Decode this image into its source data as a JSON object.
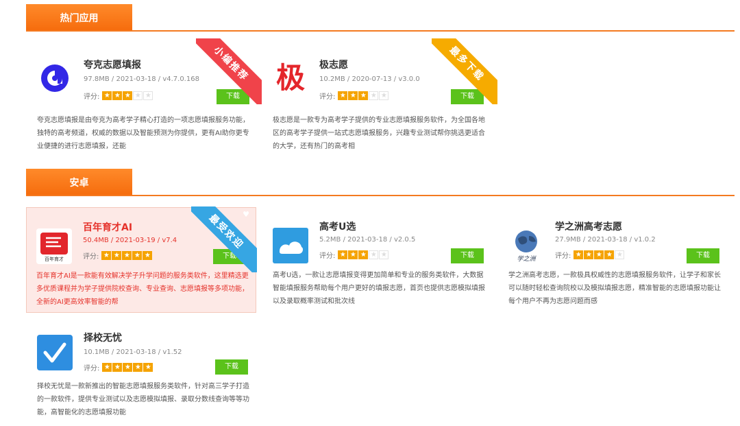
{
  "sections": {
    "hot": {
      "title": "热门应用"
    },
    "android": {
      "title": "安卓"
    }
  },
  "rating_label": "评分:",
  "download_label": "下载",
  "apps": {
    "kuake": {
      "title": "夸克志愿填报",
      "meta": "97.8MB / 2021-03-18 / v4.7.0.168",
      "rating": 3,
      "badge": "小编推荐",
      "badge_color": "#f0434a",
      "description": "夸克志愿填报是由夸克为高考学子精心打造的一项志愿填报服务功能，独特的高考频道，权威的数据以及智能预测为你提供，更有AI助你更专业便捷的进行志愿填报，还能"
    },
    "ji": {
      "title": "极志愿",
      "icon_char": "极",
      "meta": "10.2MB / 2020-07-13 / v3.0.0",
      "rating": 3,
      "badge": "最多下载",
      "badge_color": "#f6ab00",
      "description": "极志愿是一款专为高考学子提供的专业志愿填报服务软件，为全国各地区的高考学子提供一站式志愿填报服务，兴趣专业测试帮你挑选更适合的大学，还有热门的高考相"
    },
    "bainian": {
      "title": "百年育才AI",
      "icon_caption": "百年育才",
      "meta": "50.4MB / 2021-03-19 / v7.4",
      "rating": 5,
      "badge": "最受欢迎",
      "badge_color": "#36a6e3",
      "description": "百年育才AI是一款能有效解决学子升学问题的服务类软件，这里精选更多优质课程并为学子提供院校查询、专业查询、志愿填报等多项功能，全新的AI更高效率智能的帮"
    },
    "gaokao_u": {
      "title": "高考U选",
      "meta": "5.2MB / 2021-03-18 / v2.0.5",
      "rating": 3,
      "description": "高考U选，一款让志愿填报变得更加简单和专业的服务类软件，大数据智能填报服务帮助每个用户更好的填报志愿，首页也提供志愿模拟填报以及录取概率测试和批次线"
    },
    "xuezhizhou": {
      "title": "学之洲高考志愿",
      "icon_caption": "学之洲",
      "meta": "27.9MB / 2021-03-18 / v1.0.2",
      "rating": 4,
      "description": "学之洲高考志愿，一款极具权威性的志愿填报服务软件，让学子和家长可以随时轻松查询院校以及模拟填报志愿，精准智能的志愿填报功能让每个用户不再为志愿问题而感"
    },
    "zexiao": {
      "title": "择校无忧",
      "meta": "10.1MB / 2021-03-18 / v1.52",
      "rating": 5,
      "description": "择校无忧是一款新推出的智能志愿填报服务类软件，针对高三学子打造的一款软件，提供专业测试以及志愿模拟填报、录取分数线查询等等功能，高智能化的志愿填报功能"
    }
  }
}
